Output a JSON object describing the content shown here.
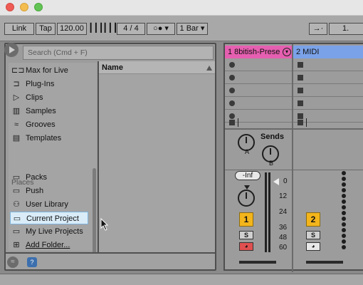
{
  "transport": {
    "link": "Link",
    "tap": "Tap",
    "tempo": "120.00",
    "signature": "4 / 4",
    "metro": "○●",
    "quantize": "1 Bar",
    "position": "1."
  },
  "search": {
    "placeholder": "Search (Cmd + F)"
  },
  "browser": {
    "categories": [
      "Max for Live",
      "Plug-Ins",
      "Clips",
      "Samples",
      "Grooves",
      "Templates"
    ],
    "places_heading": "Places",
    "places": [
      "Packs",
      "Push",
      "User Library",
      "Current Project",
      "My Live Projects",
      "Add Folder..."
    ],
    "selected_place": "Current Project",
    "column_header": "Name"
  },
  "session": {
    "tracks": [
      {
        "name": "1 8bitish-Prese",
        "color": "#e55fb0",
        "number": "1"
      },
      {
        "name": "2 MIDI",
        "color": "#7aa2e8",
        "number": "2"
      }
    ],
    "sends_label": "Sends",
    "send_a": "A",
    "send_b": "B",
    "volume": "-Inf",
    "solo": "S",
    "meter_scale": [
      "0",
      "12",
      "24",
      "36",
      "48",
      "60"
    ]
  }
}
